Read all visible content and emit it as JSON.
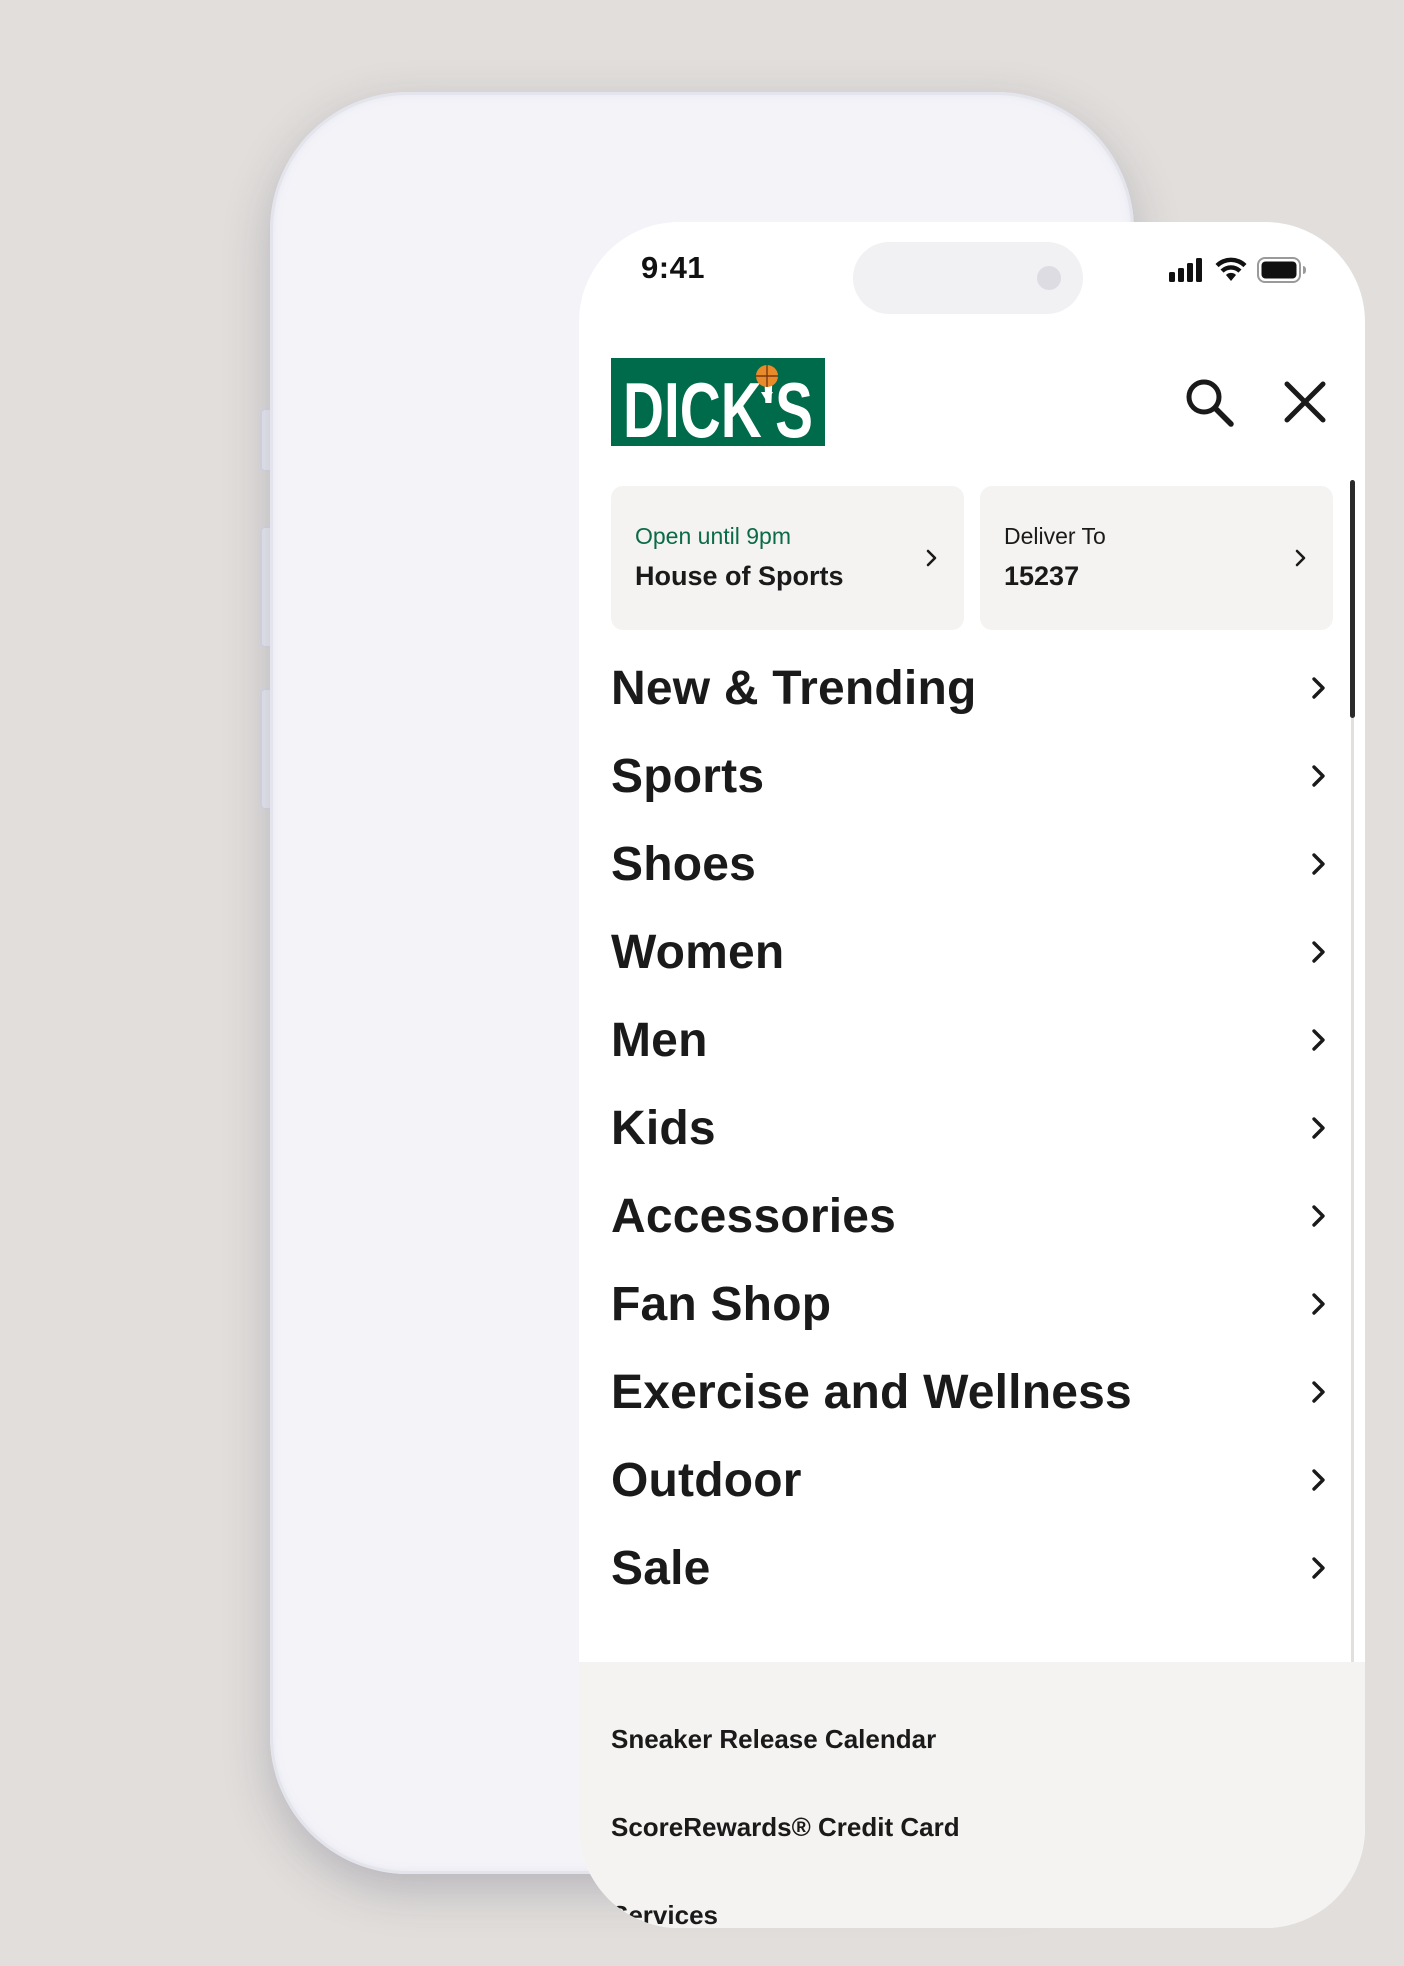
{
  "status_bar": {
    "time": "9:41"
  },
  "brand": {
    "name": "DICK'S",
    "color": "#006b4a",
    "accent": "#e98a2b"
  },
  "header": {
    "search_icon": "search-icon",
    "close_icon": "close-icon"
  },
  "store_card": {
    "subtitle": "Open until 9pm",
    "title": "House of Sports",
    "subtitle_color": "#0b6a4a"
  },
  "deliver_card": {
    "subtitle": "Deliver To",
    "title": "15237"
  },
  "menu": {
    "items": [
      {
        "label": "New & Trending"
      },
      {
        "label": "Sports"
      },
      {
        "label": "Shoes"
      },
      {
        "label": "Women"
      },
      {
        "label": "Men"
      },
      {
        "label": "Kids"
      },
      {
        "label": "Accessories"
      },
      {
        "label": "Fan Shop"
      },
      {
        "label": "Exercise and Wellness"
      },
      {
        "label": "Outdoor"
      },
      {
        "label": "Sale"
      }
    ]
  },
  "footer": {
    "links": [
      {
        "label": "Sneaker Release Calendar"
      },
      {
        "label": "ScoreRewards® Credit Card"
      },
      {
        "label": "Services"
      }
    ]
  }
}
